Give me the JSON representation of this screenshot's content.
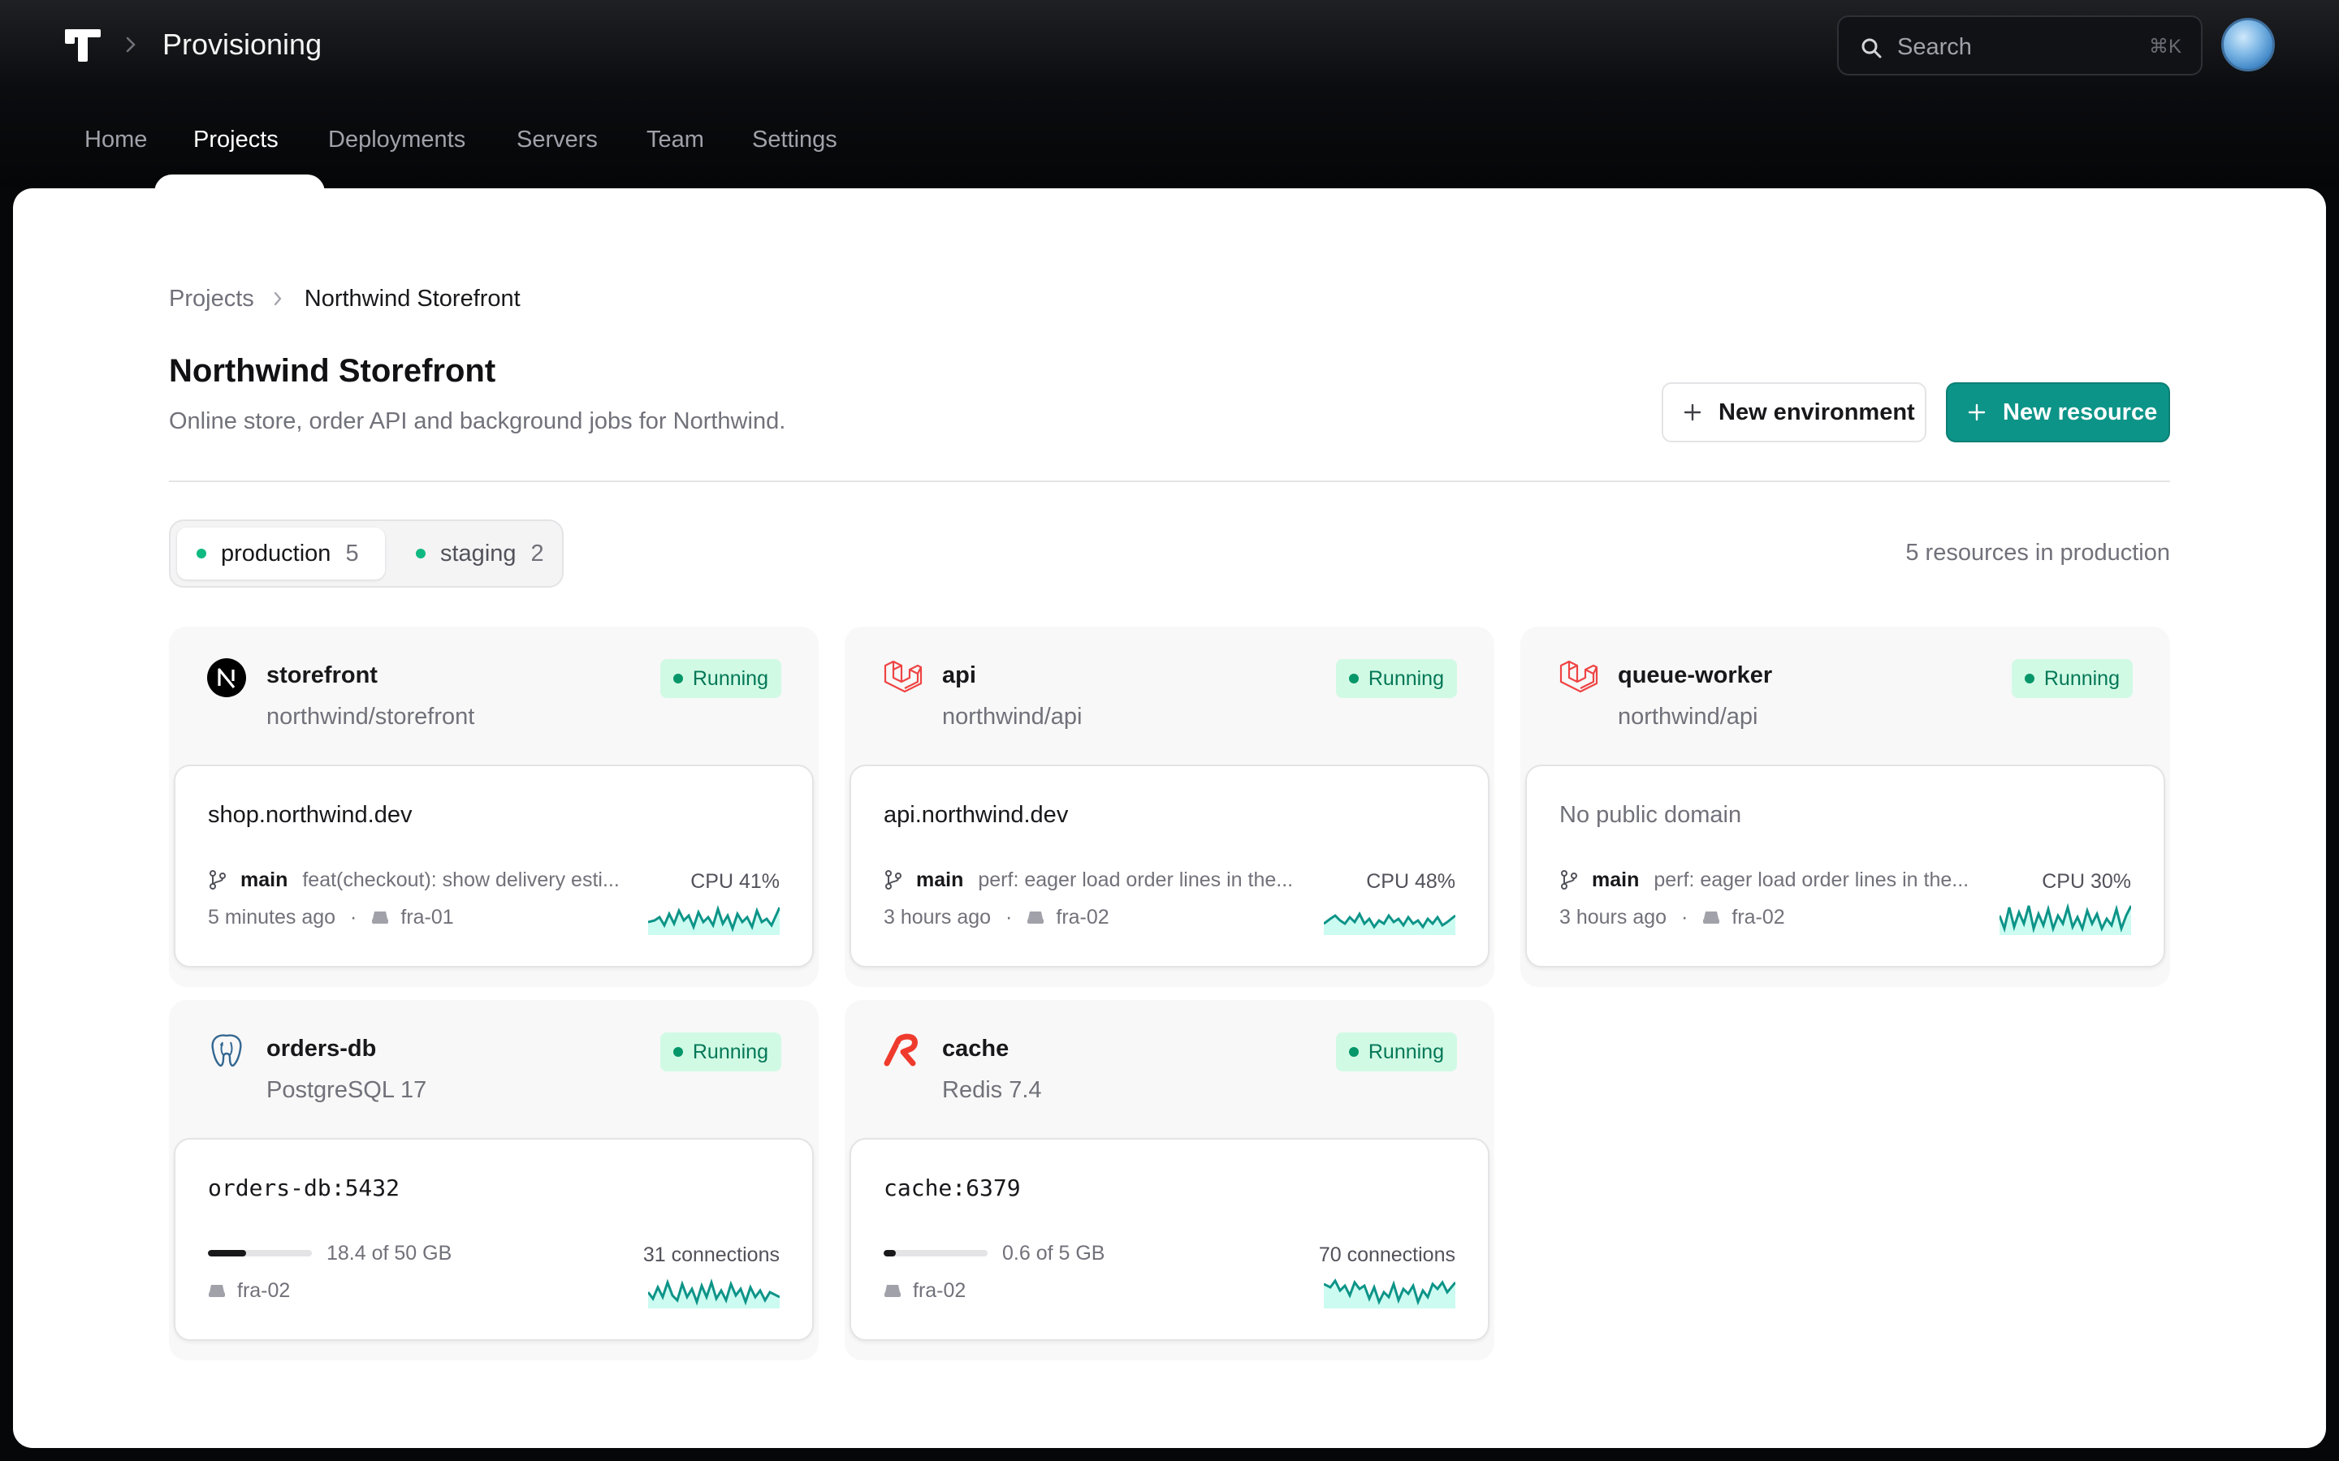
{
  "header": {
    "app_title": "Provisioning",
    "search_placeholder": "Search",
    "search_shortcut": "⌘K",
    "nav": [
      "Home",
      "Projects",
      "Deployments",
      "Servers",
      "Team",
      "Settings"
    ],
    "active_nav": "Projects"
  },
  "breadcrumb": {
    "parent": "Projects",
    "current": "Northwind Storefront"
  },
  "page": {
    "title": "Northwind Storefront",
    "description": "Online store, order API and background jobs for Northwind.",
    "new_environment_label": "New environment",
    "new_resource_label": "New resource"
  },
  "environments": [
    {
      "name": "production",
      "count": "5",
      "active": true
    },
    {
      "name": "staging",
      "count": "2",
      "active": false
    }
  ],
  "resource_count_text": "5 resources in production",
  "colors": {
    "accent": "#0d9488",
    "running": "#047857",
    "laravel": "#ef4444"
  },
  "resources": [
    {
      "name": "storefront",
      "subtitle": "northwind/storefront",
      "icon": "nextjs-icon",
      "status": "Running",
      "domain": "shop.northwind.dev",
      "branch": "main",
      "commit": "feat(checkout): show delivery esti...",
      "time": "5 minutes ago",
      "server": "fra-01",
      "metric": "CPU 41%"
    },
    {
      "name": "api",
      "subtitle": "northwind/api",
      "icon": "laravel-icon",
      "status": "Running",
      "domain": "api.northwind.dev",
      "branch": "main",
      "commit": "perf: eager load order lines in the...",
      "time": "3 hours ago",
      "server": "fra-02",
      "metric": "CPU 48%"
    },
    {
      "name": "queue-worker",
      "subtitle": "northwind/api",
      "icon": "laravel-icon",
      "status": "Running",
      "domain": "No public domain",
      "branch": "main",
      "commit": "perf: eager load order lines in the...",
      "time": "3 hours ago",
      "server": "fra-02",
      "metric": "CPU 30%"
    },
    {
      "name": "orders-db",
      "subtitle": "PostgreSQL 17",
      "icon": "postgresql-icon",
      "status": "Running",
      "domain": "orders-db:5432",
      "storage": "18.4 of 50 GB",
      "storage_fraction": 0.368,
      "server": "fra-02",
      "metric": "31 connections"
    },
    {
      "name": "cache",
      "subtitle": "Redis 7.4",
      "icon": "redis-icon",
      "status": "Running",
      "domain": "cache:6379",
      "storage": "0.6 of 5 GB",
      "storage_fraction": 0.12,
      "server": "fra-02",
      "metric": "70 connections"
    }
  ]
}
